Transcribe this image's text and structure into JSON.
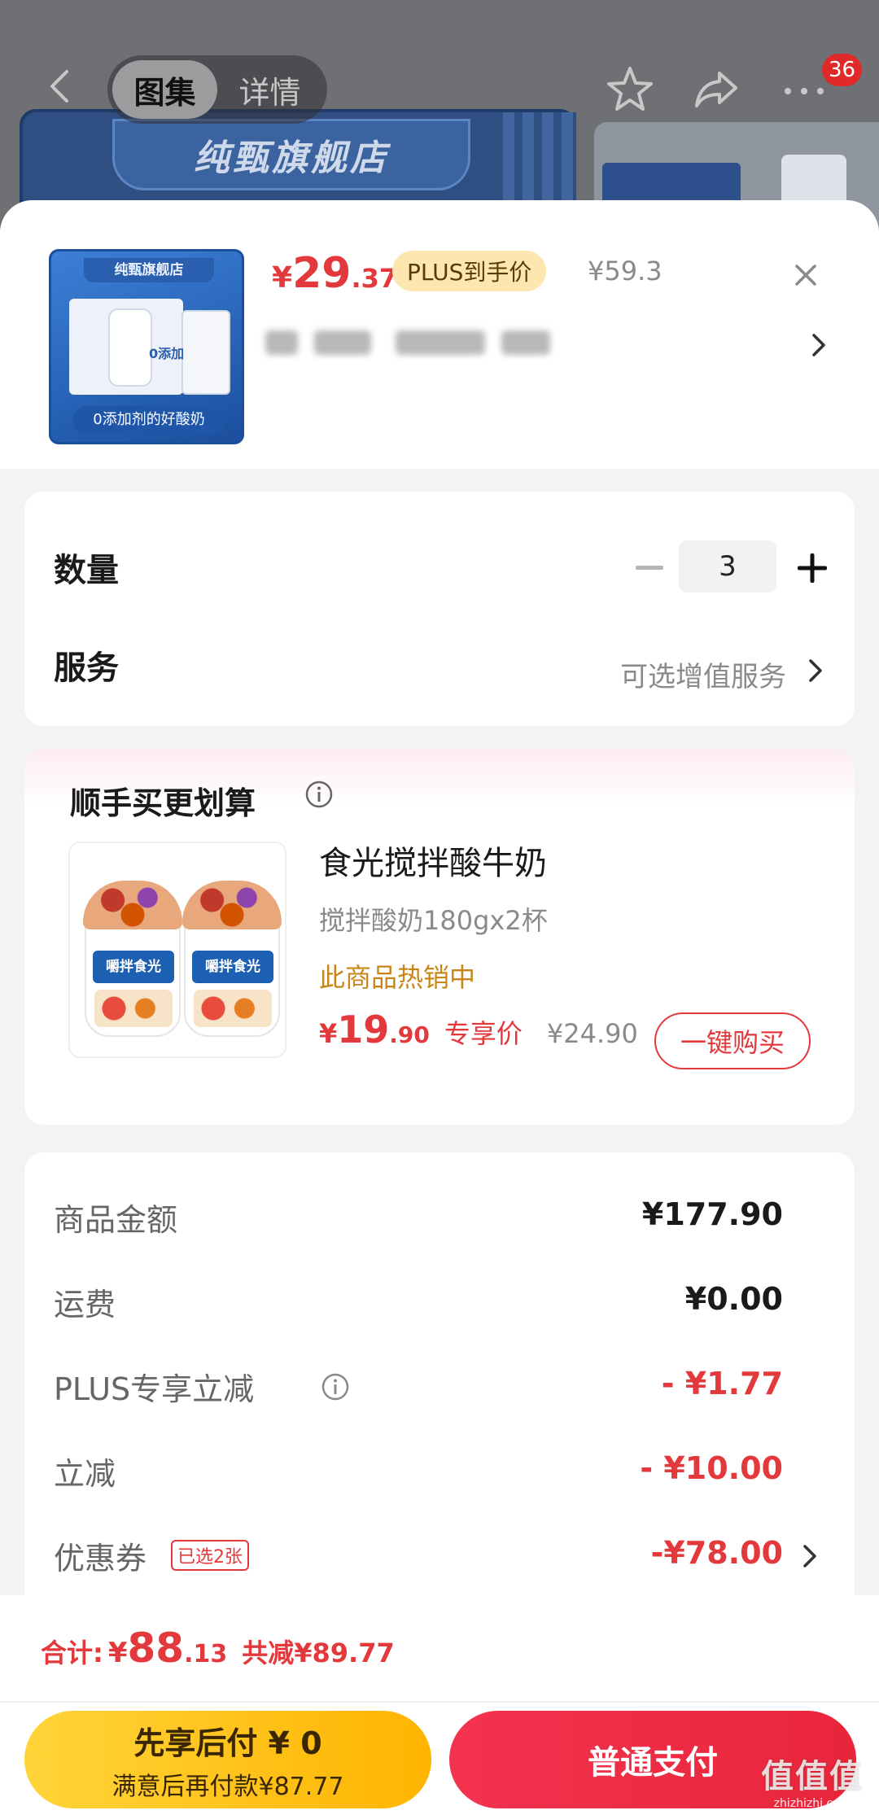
{
  "top_nav": {
    "tabs": [
      "图集",
      "详情"
    ],
    "message_badge": "36",
    "background_store_title": "纯甄旗舰店"
  },
  "product": {
    "thumbnail": {
      "store_label": "纯甄旗舰店",
      "badge_text": "0添加",
      "caption": "0添加剂的好酸奶"
    },
    "price_yen": "¥",
    "price_int": "29",
    "price_dec": ".37",
    "plus_tag": "PLUS到手价",
    "original_price": "¥59.3"
  },
  "quantity": {
    "label": "数量",
    "value": "3"
  },
  "service": {
    "label": "服务",
    "value": "可选增值服务"
  },
  "addon": {
    "title": "顺手买更划算",
    "product_name": "食光搅拌酸牛奶",
    "spec": "搅拌酸奶180gx2杯",
    "hot_text": "此商品热销中",
    "image_label": "嚼拌食光",
    "price_yen": "¥",
    "price_int": "19",
    "price_dec": ".90",
    "price_tag": "专享价",
    "original_price": "¥24.90",
    "buy_button": "一键购买"
  },
  "summary": {
    "rows": [
      {
        "label": "商品金额",
        "value": "¥177.90"
      },
      {
        "label": "运费",
        "value": "¥0.00"
      },
      {
        "label": "PLUS专享立减",
        "value": "- ¥1.77"
      },
      {
        "label": "立减",
        "value": "- ¥10.00"
      },
      {
        "label": "优惠券",
        "value": "-¥78.00",
        "tag": "已选2张"
      }
    ]
  },
  "footer": {
    "total_label": "合计:",
    "total_yen": "¥",
    "total_int": "88",
    "total_dec": ".13",
    "total_reduce": "共减¥89.77",
    "pay_later_main": "先享后付 ¥ 0",
    "pay_later_sub": "满意后再付款¥87.77",
    "pay_normal": "普通支付"
  },
  "watermark": {
    "main": "值值值",
    "sub": "zhizhizhi.com"
  },
  "colors": {
    "accent_red": "#e4393c",
    "plus_tag_bg": "#fde6b0",
    "pay_later_yellow": "#ffc21a",
    "hot_text": "#c8861a"
  },
  "icons": [
    "back-icon",
    "star-icon",
    "share-icon",
    "more-icon",
    "close-icon",
    "chevron-right-icon",
    "minus-icon",
    "plus-icon",
    "info-icon"
  ]
}
